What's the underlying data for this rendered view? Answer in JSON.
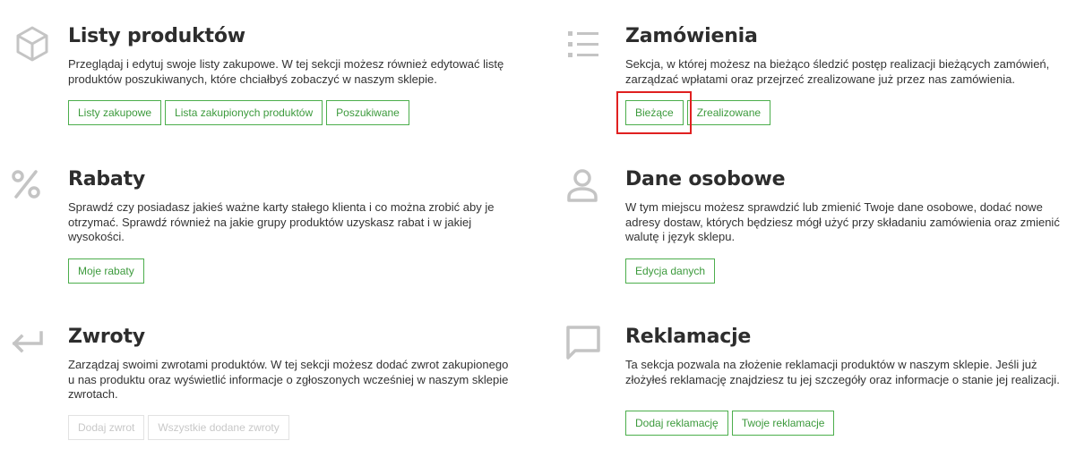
{
  "colors": {
    "accent": "#3c9a3c",
    "icon": "#c4c4c4",
    "highlight": "#e02020",
    "disabled": "#c8c8c8"
  },
  "sections": {
    "lists": {
      "icon": "box-icon",
      "title": "Listy produktów",
      "desc": "Przeglądaj i edytuj swoje listy zakupowe. W tej sekcji możesz również edytować listę produktów poszukiwanych, które chciałbyś zobaczyć w naszym sklepie.",
      "buttons": [
        "Listy zakupowe",
        "Lista zakupionych produktów",
        "Poszukiwane"
      ]
    },
    "orders": {
      "icon": "list-icon",
      "title": "Zamówienia",
      "desc": "Sekcja, w której możesz na bieżąco śledzić postęp realizacji bieżących zamówień, zarządzać wpłatami oraz przejrzeć zrealizowane już przez nas zamówienia.",
      "buttons": [
        "Bieżące",
        "Zrealizowane"
      ]
    },
    "discounts": {
      "icon": "percent-icon",
      "title": "Rabaty",
      "desc": "Sprawdź czy posiadasz jakieś ważne karty stałego klienta i co można zrobić aby je otrzymać. Sprawdź również na jakie grupy produktów uzyskasz rabat i w jakiej wysokości.",
      "buttons": [
        "Moje rabaty"
      ]
    },
    "personal": {
      "icon": "user-icon",
      "title": "Dane osobowe",
      "desc": "W tym miejscu możesz sprawdzić lub zmienić Twoje dane osobowe, dodać nowe adresy dostaw, których będziesz mógł użyć przy składaniu zamówienia oraz zmienić walutę i język sklepu.",
      "buttons": [
        "Edycja danych"
      ]
    },
    "returns": {
      "icon": "return-arrow-icon",
      "title": "Zwroty",
      "desc": "Zarządzaj swoimi zwrotami produktów. W tej sekcji możesz dodać zwrot zakupionego u nas produktu oraz wyświetlić informacje o zgłoszonych wcześniej w naszym sklepie zwrotach.",
      "buttons": [
        "Dodaj zwrot",
        "Wszystkie dodane zwroty"
      ]
    },
    "complaints": {
      "icon": "chat-bubble-icon",
      "title": "Reklamacje",
      "desc": "Ta sekcja pozwala na złożenie reklamacji produktów w naszym sklepie. Jeśli już złożyłeś reklamację znajdziesz tu jej szczegóły oraz informacje o stanie jej realizacji.",
      "buttons": [
        "Dodaj reklamację",
        "Twoje reklamacje"
      ]
    }
  }
}
